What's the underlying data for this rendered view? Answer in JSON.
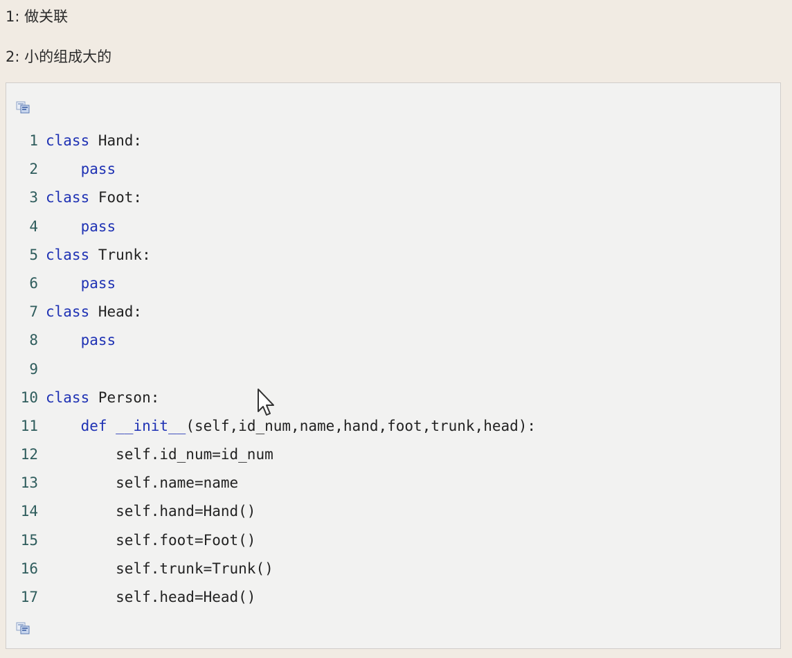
{
  "intro": {
    "line1": "1: 做关联",
    "line2": "2: 小的组成大的"
  },
  "toolbar": {
    "copy_icon": "copy-code-icon"
  },
  "code": {
    "lines": [
      {
        "num": "1",
        "indent": "",
        "keyword": "class",
        "rest": " Hand:"
      },
      {
        "num": "2",
        "indent": "    ",
        "keyword": "pass",
        "rest": ""
      },
      {
        "num": "3",
        "indent": "",
        "keyword": "class",
        "rest": " Foot:"
      },
      {
        "num": "4",
        "indent": "    ",
        "keyword": "pass",
        "rest": ""
      },
      {
        "num": "5",
        "indent": "",
        "keyword": "class",
        "rest": " Trunk:"
      },
      {
        "num": "6",
        "indent": "    ",
        "keyword": "pass",
        "rest": ""
      },
      {
        "num": "7",
        "indent": "",
        "keyword": "class",
        "rest": " Head:"
      },
      {
        "num": "8",
        "indent": "    ",
        "keyword": "pass",
        "rest": ""
      },
      {
        "num": "9",
        "indent": "",
        "keyword": "",
        "rest": ""
      },
      {
        "num": "10",
        "indent": "",
        "keyword": "class",
        "rest": " Person:"
      },
      {
        "num": "11",
        "indent": "    ",
        "keyword": "def",
        "rest": " ",
        "func": "__init__",
        "after": "(self,id_num,name,hand,foot,trunk,head):"
      },
      {
        "num": "12",
        "indent": "        ",
        "keyword": "",
        "rest": "self.id_num=id_num"
      },
      {
        "num": "13",
        "indent": "        ",
        "keyword": "",
        "rest": "self.name=name"
      },
      {
        "num": "14",
        "indent": "        ",
        "keyword": "",
        "rest": "self.hand=Hand()"
      },
      {
        "num": "15",
        "indent": "        ",
        "keyword": "",
        "rest": "self.foot=Foot()"
      },
      {
        "num": "16",
        "indent": "        ",
        "keyword": "",
        "rest": "self.trunk=Trunk()"
      },
      {
        "num": "17",
        "indent": "        ",
        "keyword": "",
        "rest": "self.head=Head()"
      }
    ]
  },
  "colors": {
    "background": "#f1ebe3",
    "code_background": "#f2f2f1",
    "keyword": "#1f32b4",
    "line_number": "#2e5c5c",
    "text": "#222222"
  }
}
